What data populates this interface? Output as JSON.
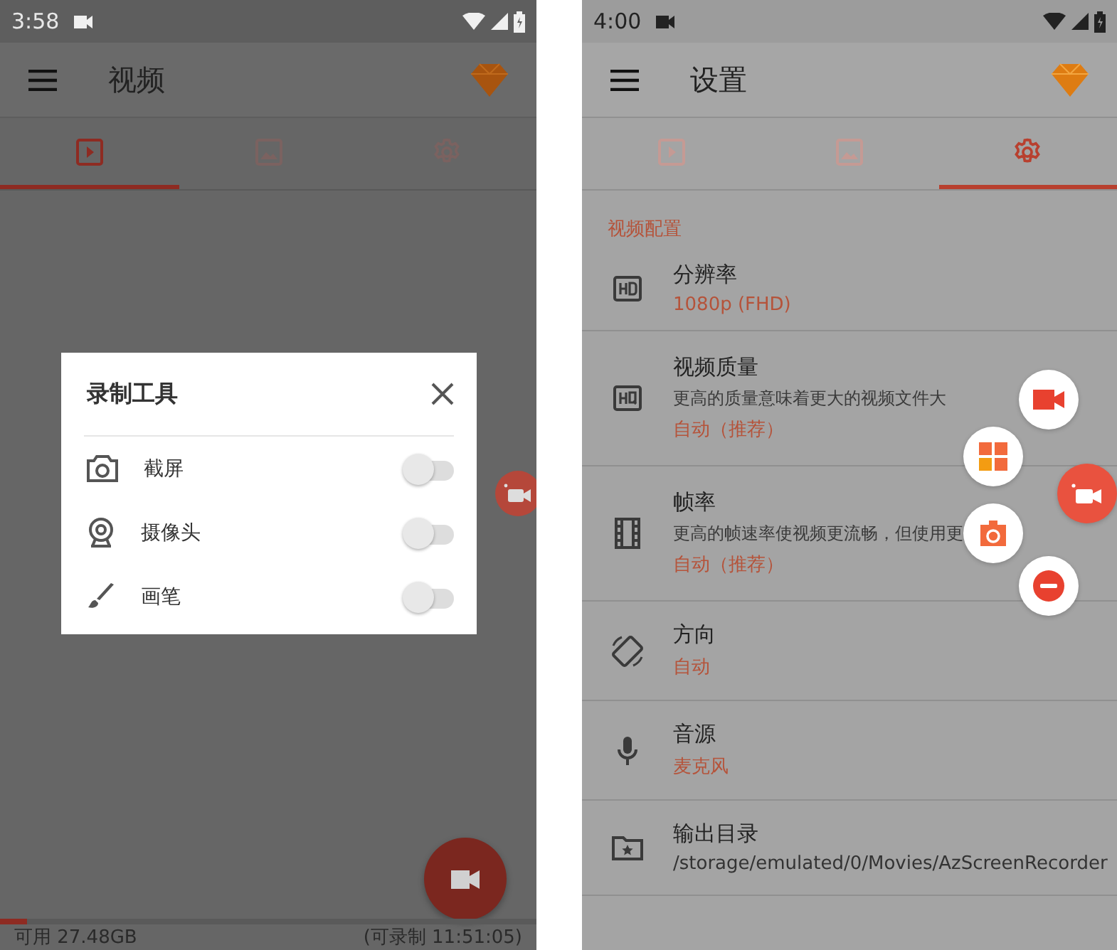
{
  "screens": [
    {
      "kind": "recorder",
      "status_bar": {
        "time": "3:58"
      },
      "app_bar": {
        "title": "视频"
      },
      "tabs": [
        {
          "selected": true
        },
        {
          "selected": false
        },
        {
          "selected": false
        }
      ],
      "dialog": {
        "title": "录制工具",
        "items": [
          {
            "label": "截屏",
            "on": false
          },
          {
            "label": "摄像头",
            "on": false
          },
          {
            "label": "画笔",
            "on": false
          }
        ]
      },
      "storage": {
        "level": 0.05,
        "available": "可用 27.48GB",
        "recordable": "(可录制 11:51:05)"
      }
    },
    {
      "kind": "settings",
      "status_bar": {
        "time": "4:00"
      },
      "app_bar": {
        "title": "设置"
      },
      "tabs": [
        {
          "selected": false
        },
        {
          "selected": false
        },
        {
          "selected": true
        }
      ],
      "section_header": "视频配置",
      "items": [
        {
          "title": "分辨率",
          "value": "1080p (FHD)"
        },
        {
          "title": "视频质量",
          "description": "更高的质量意味着更大的视频文件大",
          "value": "自动（推荐）"
        },
        {
          "title": "帧率",
          "description": "更高的帧速率使视频更流畅，但使用更",
          "value": "自动（推荐）"
        },
        {
          "title": "方向",
          "value": "自动"
        },
        {
          "title": "音源",
          "value": "麦克风"
        },
        {
          "title": "输出目录",
          "value": "/storage/emulated/0/Movies/AzScreenRecorder"
        }
      ]
    }
  ]
}
